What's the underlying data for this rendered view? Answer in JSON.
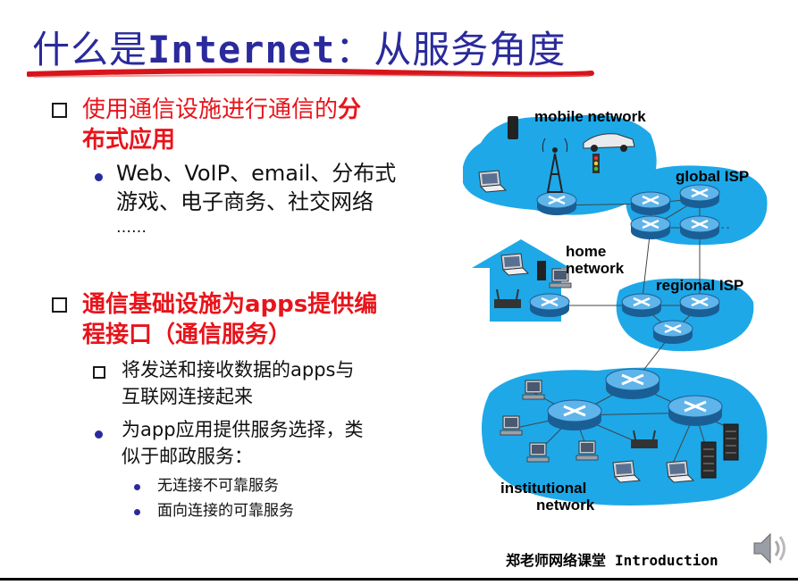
{
  "title": {
    "part1": "什么是",
    "part2": "Internet",
    "part3": "：从服务角度"
  },
  "bullets": {
    "b1_line1_normal": "使用通信设施进行通信的",
    "b1_line1_bold": "分",
    "b1_line2": "布式应用",
    "b1_sub_line1": "Web、VoIP、email、分布式",
    "b1_sub_line2": "游戏、电子商务、社交网络",
    "b1_sub_line3": "……",
    "b2_line1": "通信基础设施为apps提供编",
    "b2_line2": "程接口（通信服务）",
    "b2_sub1_line1": "将发送和接收数据的apps与",
    "b2_sub1_line2": "互联网连接起来",
    "b2_sub2_line1": "为app应用提供服务选择，类",
    "b2_sub2_line2": "似于邮政服务：",
    "b2_sub2_item1": "无连接不可靠服务",
    "b2_sub2_item2": "面向连接的可靠服务"
  },
  "diagram": {
    "mobile_network": "mobile network",
    "global_isp": "global ISP",
    "home_network_1": "home",
    "home_network_2": "network",
    "regional_isp": "regional ISP",
    "institutional_1": "institutional",
    "institutional_2": "network"
  },
  "footer": {
    "cn": "郑老师网络课堂",
    "en": "Introduction"
  },
  "icons": [
    "speaker-icon",
    "router-icon",
    "laptop-icon",
    "server-icon",
    "cell-tower-icon",
    "car-icon",
    "phone-icon",
    "traffic-light-icon"
  ],
  "colors": {
    "title": "#2a2a9c",
    "bullet_red": "#e8141b",
    "network_blue": "#1ea8e8",
    "underline_red": "#d8141b"
  }
}
